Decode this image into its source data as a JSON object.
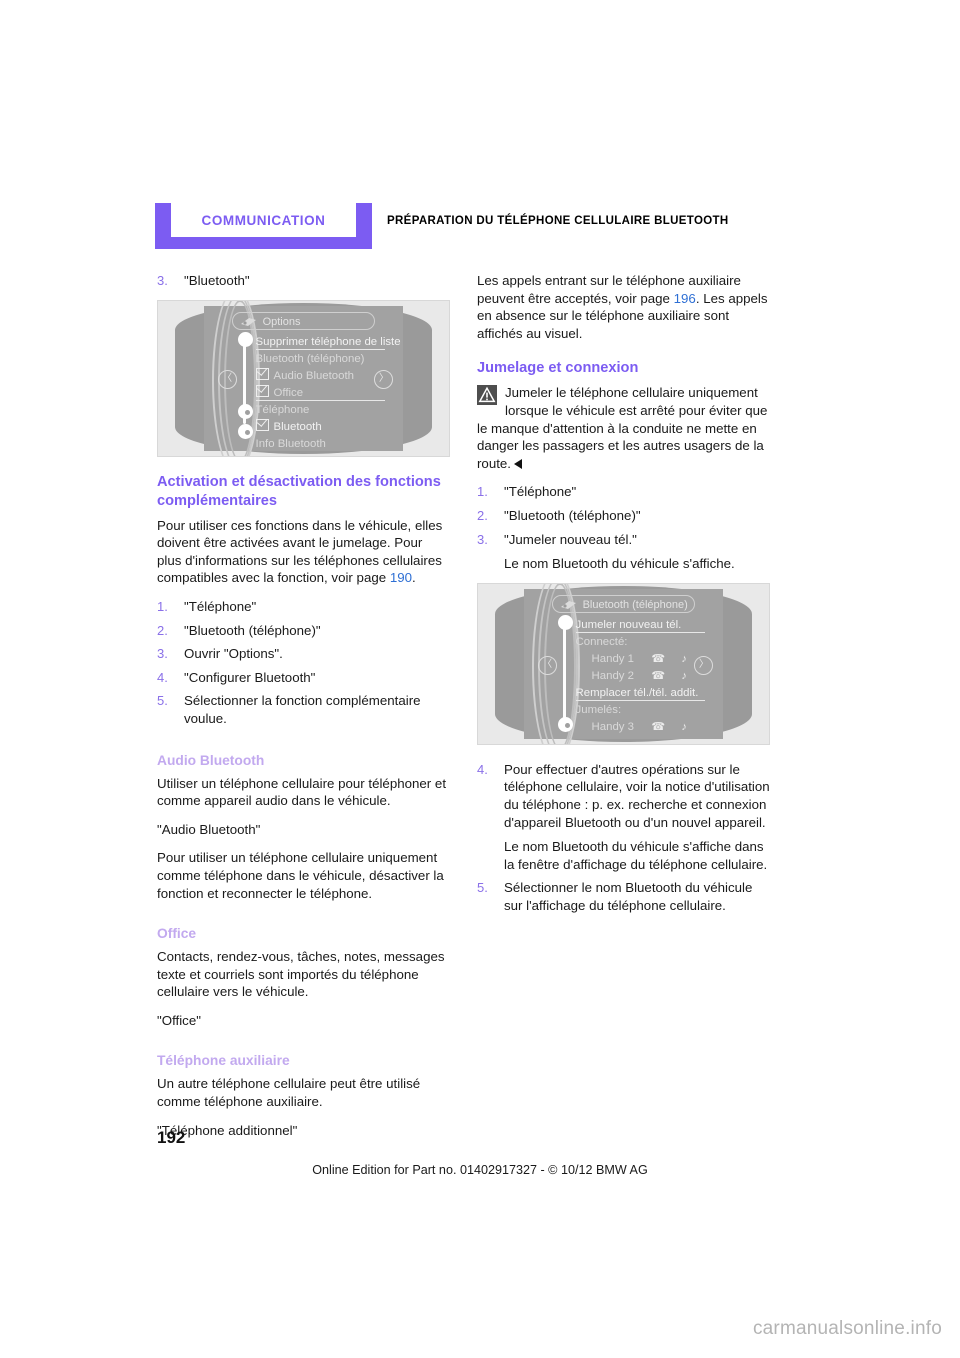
{
  "header": {
    "chapter": "COMMUNICATION",
    "section_title": "PRÉPARATION DU TÉLÉPHONE CELLULAIRE BLUETOOTH",
    "accent_color": "#7c5cf2"
  },
  "colors": {
    "heading_1": "#7c5cf2",
    "heading_2": "#c2a9ef",
    "step_number": "#8a70e8",
    "page_reference": "#2e6fd4",
    "body_text": "#1a1a1a"
  },
  "left_column": {
    "lead_step": {
      "number": "3.",
      "text": "\"Bluetooth\""
    },
    "figure_1": {
      "name": "idrive-bluetooth-options-screen",
      "option_pill": "Options",
      "rows": [
        {
          "label": "Supprimer téléphone de liste",
          "style": "bright underline"
        },
        {
          "label": "Bluetooth (téléphone)",
          "style": "dim"
        },
        {
          "label": "Audio Bluetooth",
          "style": "checkbox"
        },
        {
          "label": "Office",
          "style": "checkbox underline"
        },
        {
          "label": "Téléphone",
          "style": "dim"
        },
        {
          "label": "Bluetooth",
          "style": "checkbox bright"
        },
        {
          "label": "Info Bluetooth",
          "style": "dim"
        }
      ]
    },
    "section_1": {
      "heading": "Activation et désactivation des fonctions complémentaires",
      "paragraph_prefix": "Pour utiliser ces fonctions dans le véhicule, elles doivent être activées avant le jumelage. Pour plus d'informations sur les téléphones cellulaires compatibles avec la fonction, voir page ",
      "page_ref": "190",
      "paragraph_suffix": ".",
      "steps": [
        "\"Téléphone\"",
        "\"Bluetooth (téléphone)\"",
        "Ouvrir \"Options\".",
        "\"Configurer Bluetooth\"",
        "Sélectionner la fonction complémentaire voulue."
      ]
    },
    "section_2": {
      "heading": "Audio Bluetooth",
      "paragraph_1": "Utiliser un téléphone cellulaire pour téléphoner et comme appareil audio dans le véhicule.",
      "paragraph_2": "\"Audio Bluetooth\"",
      "paragraph_3": "Pour utiliser un téléphone cellulaire uniquement comme téléphone dans le véhicule, désactiver la fonction et reconnecter le téléphone."
    },
    "section_3": {
      "heading": "Office",
      "paragraph_1": "Contacts, rendez-vous, tâches, notes, messages texte et courriels sont importés du téléphone cellulaire vers le véhicule.",
      "paragraph_2": "\"Office\""
    },
    "section_4": {
      "heading": "Téléphone auxiliaire",
      "paragraph_1": "Un autre téléphone cellulaire peut être utilisé comme téléphone auxiliaire.",
      "paragraph_2": "\"Téléphone additionnel\""
    }
  },
  "right_column": {
    "intro": {
      "prefix": "Les appels entrant sur le téléphone auxiliaire peuvent être acceptés, voir page ",
      "page_ref": "196",
      "suffix": ". Les appels en absence sur le téléphone auxiliaire sont affichés au visuel."
    },
    "section_1": {
      "heading": "Jumelage et connexion",
      "warning_icon": "warning-triangle-icon",
      "warning_text": "Jumeler le téléphone cellulaire uniquement lorsque le véhicule est arrêté pour éviter que le manque d'attention à la conduite ne mette en danger les passagers et les autres usagers de la route.",
      "steps": [
        "\"Téléphone\"",
        "\"Bluetooth (téléphone)\"",
        "\"Jumeler nouveau tél.\""
      ],
      "step_3_note": "Le nom Bluetooth du véhicule s'affiche."
    },
    "figure_2": {
      "name": "idrive-bluetooth-pairing-screen",
      "option_pill": "Bluetooth (téléphone)",
      "rows": [
        {
          "label": "Jumeler nouveau tél.",
          "style": "bright underline"
        },
        {
          "label": "Connecté:",
          "style": "dim"
        },
        {
          "label": "Handy 1",
          "style": "indent icons"
        },
        {
          "label": "Handy 2",
          "style": "indent icons"
        },
        {
          "label": "Remplacer tél./tél. addit.",
          "style": "bright underline"
        },
        {
          "label": "Jumelés:",
          "style": "dim"
        },
        {
          "label": "Handy 3",
          "style": "indent icons"
        }
      ]
    },
    "steps_continued": [
      {
        "number": "4.",
        "text": "Pour effectuer d'autres opérations sur le téléphone cellulaire, voir la notice d'utilisation du téléphone : p. ex. recherche et connexion d'appareil Bluetooth ou d'un nouvel appareil.",
        "note": "Le nom Bluetooth du véhicule s'affiche dans la fenêtre d'affichage du téléphone cellulaire."
      },
      {
        "number": "5.",
        "text": "Sélectionner le nom Bluetooth du véhicule sur l'affichage du téléphone cellulaire."
      }
    ]
  },
  "footer": {
    "page_number": "192",
    "edition_line": "Online Edition for Part no. 01402917327 - © 10/12 BMW AG",
    "watermark": "carmanualsonline.info"
  }
}
